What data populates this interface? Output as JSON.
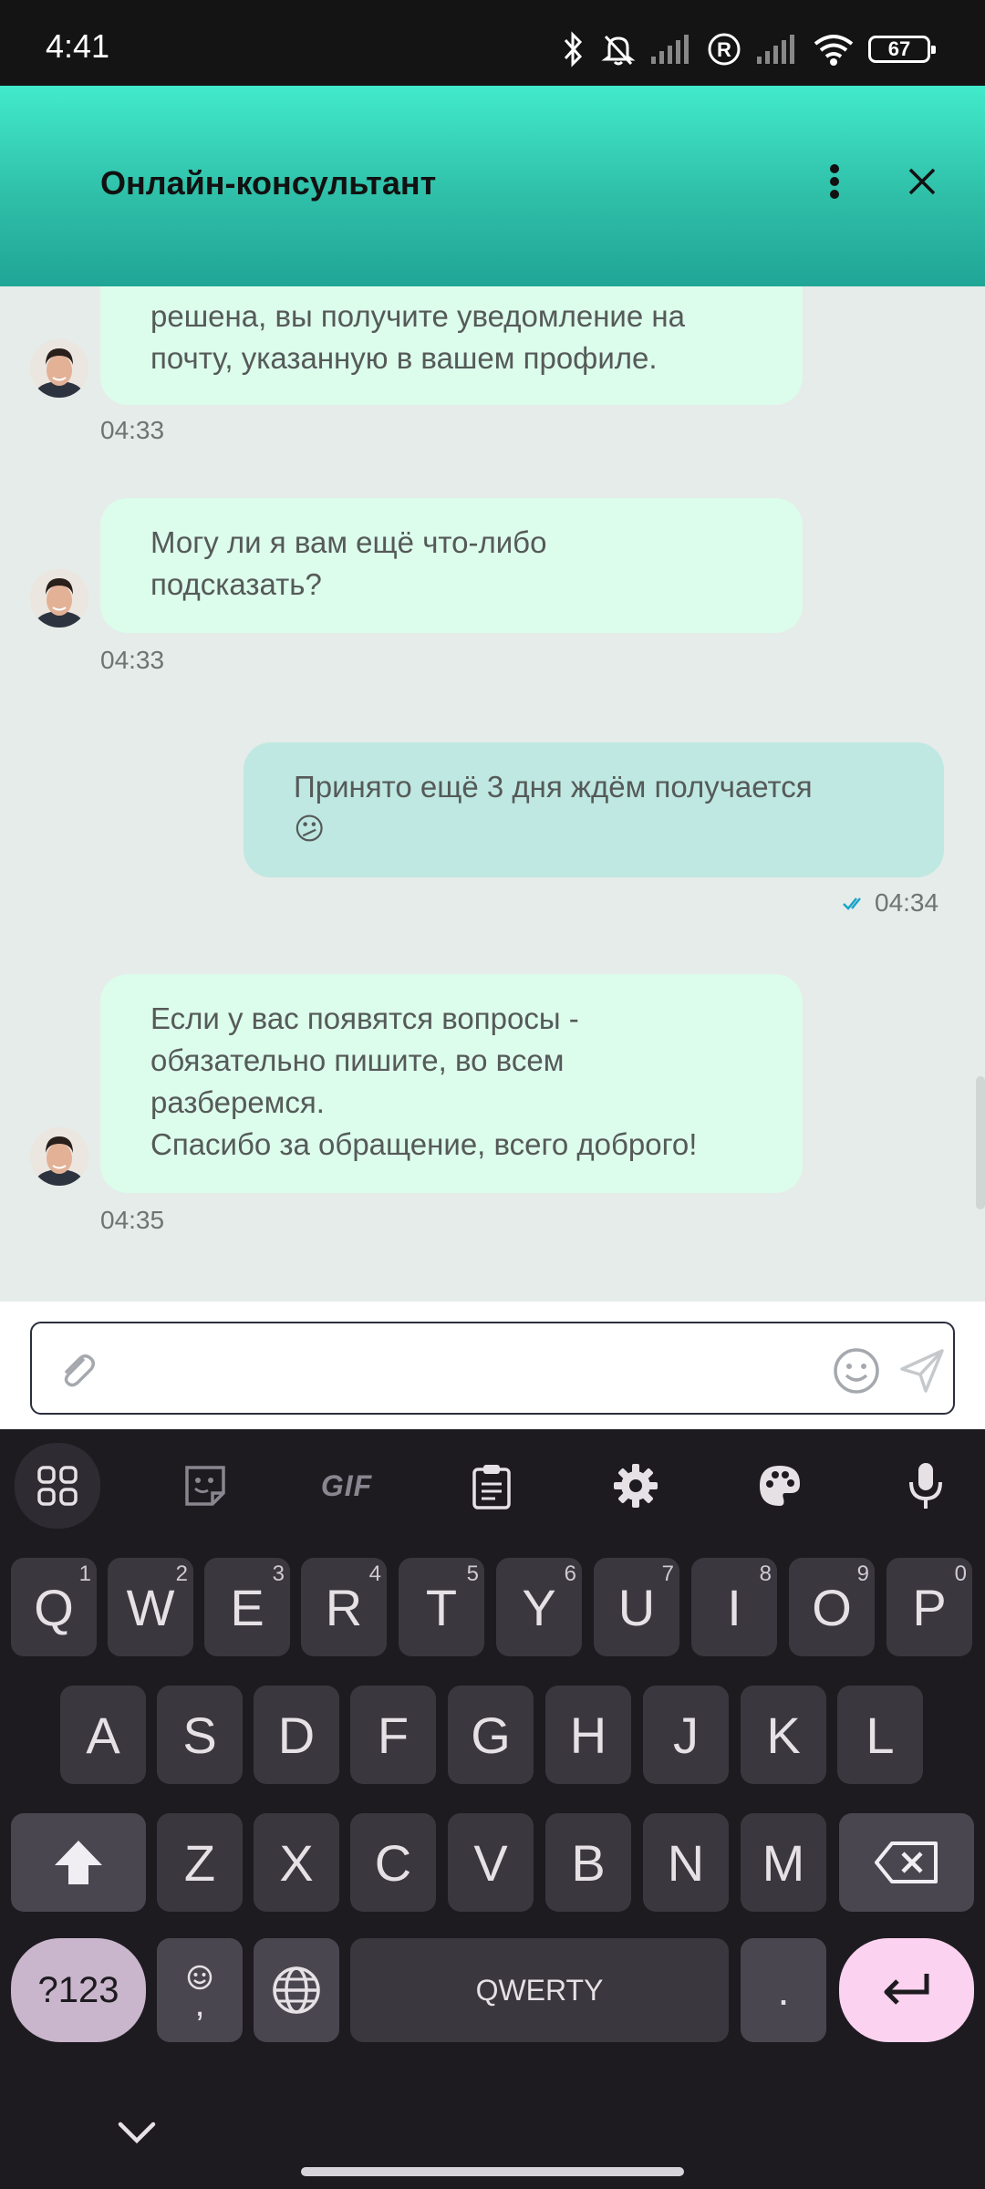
{
  "status_bar": {
    "time": "4:41",
    "battery": "67"
  },
  "header": {
    "title": "Онлайн-консультант"
  },
  "messages": [
    {
      "side": "in",
      "lines": [
        "решена, вы получите уведомление на",
        "почту, указанную в вашем профиле."
      ],
      "time": "04:33"
    },
    {
      "side": "in",
      "lines": [
        "Могу ли я вам ещё что-либо",
        "подсказать?"
      ],
      "time": "04:33"
    },
    {
      "side": "out",
      "lines": [
        "Принято ещё 3 дня ждём получается",
        "😕"
      ],
      "time": "04:34"
    },
    {
      "side": "in",
      "lines": [
        "Если у вас появятся вопросы -",
        "обязательно пишите, во всем",
        "разберемся.",
        "Спасибо за обращение, всего доброго!"
      ],
      "time": "04:35"
    }
  ],
  "input": {
    "placeholder": "",
    "value": ""
  },
  "keyboard": {
    "row1": [
      {
        "k": "Q",
        "h": "1"
      },
      {
        "k": "W",
        "h": "2"
      },
      {
        "k": "E",
        "h": "3"
      },
      {
        "k": "R",
        "h": "4"
      },
      {
        "k": "T",
        "h": "5"
      },
      {
        "k": "Y",
        "h": "6"
      },
      {
        "k": "U",
        "h": "7"
      },
      {
        "k": "I",
        "h": "8"
      },
      {
        "k": "O",
        "h": "9"
      },
      {
        "k": "P",
        "h": "0"
      }
    ],
    "row2": [
      "A",
      "S",
      "D",
      "F",
      "G",
      "H",
      "J",
      "K",
      "L"
    ],
    "row3": [
      "Z",
      "X",
      "C",
      "V",
      "B",
      "N",
      "M"
    ],
    "sym_label": "?123",
    "comma_label": ",",
    "space_label": "QWERTY",
    "period_label": "."
  }
}
